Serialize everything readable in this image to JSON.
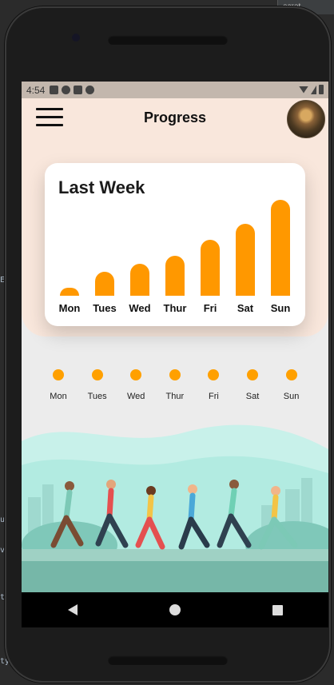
{
  "ide": {
    "tab_label": "ecret"
  },
  "status_bar": {
    "time": "4:54"
  },
  "app": {
    "title": "Progress"
  },
  "card": {
    "title": "Last Week"
  },
  "chart_data": {
    "type": "bar",
    "title": "Last Week",
    "categories": [
      "Mon",
      "Tues",
      "Wed",
      "Thur",
      "Fri",
      "Sat",
      "Sun"
    ],
    "values": [
      1,
      3,
      4,
      5,
      7,
      9,
      12
    ],
    "ylim": [
      0,
      12
    ],
    "color": "#ff9800",
    "grid": false
  },
  "days": [
    {
      "label": "Mon"
    },
    {
      "label": "Tues"
    },
    {
      "label": "Wed"
    },
    {
      "label": "Thur"
    },
    {
      "label": "Fri"
    },
    {
      "label": "Sat"
    },
    {
      "label": "Sun"
    }
  ],
  "colors": {
    "accent": "#ff9800",
    "header_bg": "#f9e7dc",
    "dot": "#ffa000",
    "nav_bar": "#000000"
  },
  "icons": {
    "menu": "hamburger-icon",
    "back": "back-triangle-icon",
    "home": "home-circle-icon",
    "recent": "recent-square-icon"
  }
}
